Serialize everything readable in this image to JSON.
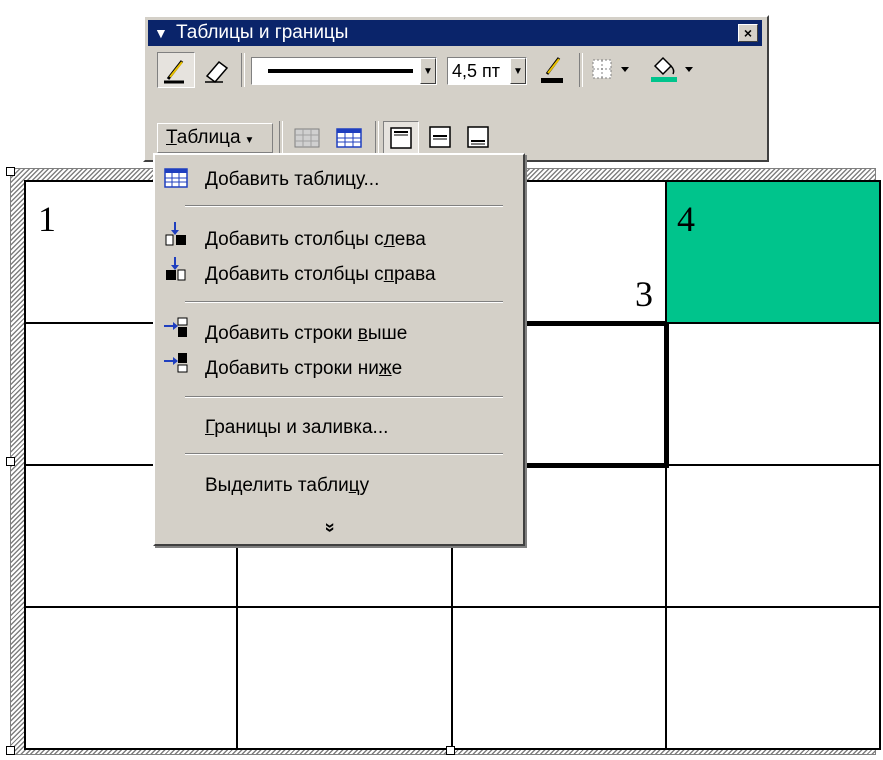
{
  "toolbar": {
    "title": "Таблицы и границы",
    "close_glyph": "×",
    "line_weight": "4,5 пт",
    "table_button": "Таблица",
    "table_button_accel": "Т",
    "table_button_rest": "аблица"
  },
  "menu": {
    "items": [
      {
        "pre": "",
        "acc": "Д",
        "post": "обавить таблицу...",
        "icon": "insert-table-icon"
      },
      {
        "pre": "Добавить столбцы с",
        "acc": "л",
        "post": "ева",
        "icon": "insert-columns-left-icon"
      },
      {
        "pre": "Добавить столбцы с",
        "acc": "п",
        "post": "рава",
        "icon": "insert-columns-right-icon"
      },
      {
        "pre": "Добавить строки ",
        "acc": "в",
        "post": "ыше",
        "icon": "insert-rows-above-icon"
      },
      {
        "pre": "Добавить строки ни",
        "acc": "ж",
        "post": "е",
        "icon": "insert-rows-below-icon"
      },
      {
        "pre": "",
        "acc": "Г",
        "post": "раницы и заливка...",
        "icon": ""
      },
      {
        "pre": "Выделить табли",
        "acc": "ц",
        "post": "у",
        "icon": ""
      }
    ],
    "more_glyph": "»"
  },
  "table": {
    "cells": [
      "1",
      "3",
      "4"
    ],
    "highlight_color": "#00c48c"
  }
}
